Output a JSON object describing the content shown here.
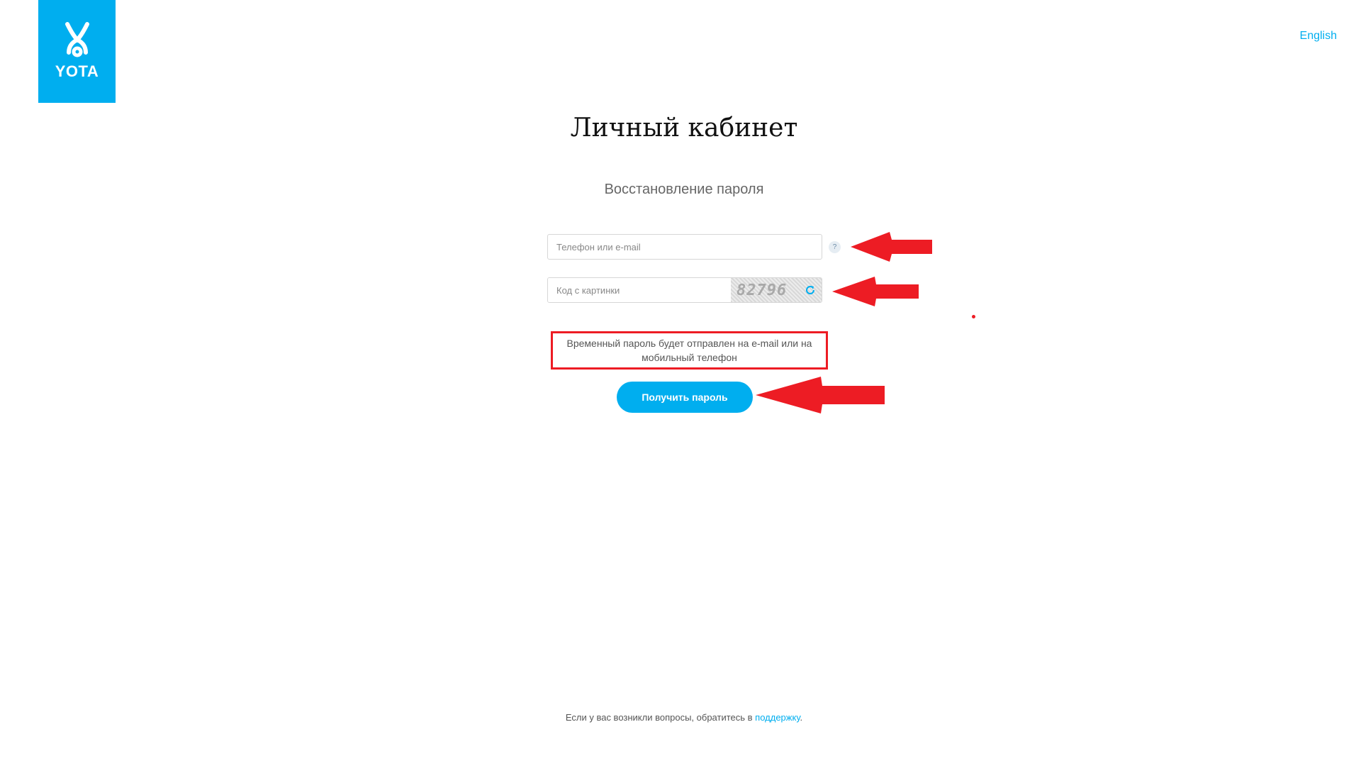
{
  "header": {
    "logo_text": "YOTA",
    "language_link": "English",
    "brand_color": "#00aeef"
  },
  "main": {
    "title": "Личный кабинет",
    "subtitle": "Восстановление пароля",
    "phone_field": {
      "placeholder": "Телефон или e-mail",
      "value": "",
      "help_icon": "?"
    },
    "captcha_field": {
      "placeholder": "Код с картинки",
      "value": "",
      "captcha_text": "82796",
      "refresh_icon": "refresh-icon"
    },
    "info_text": "Временный пароль будет отправлен на e-mail или на мобильный телефон",
    "submit_label": "Получить пароль"
  },
  "annotations": {
    "color": "#ed1c24"
  },
  "footer": {
    "text": "Если у вас возникли вопросы, обратитесь в ",
    "link": "поддержку",
    "suffix": "."
  }
}
